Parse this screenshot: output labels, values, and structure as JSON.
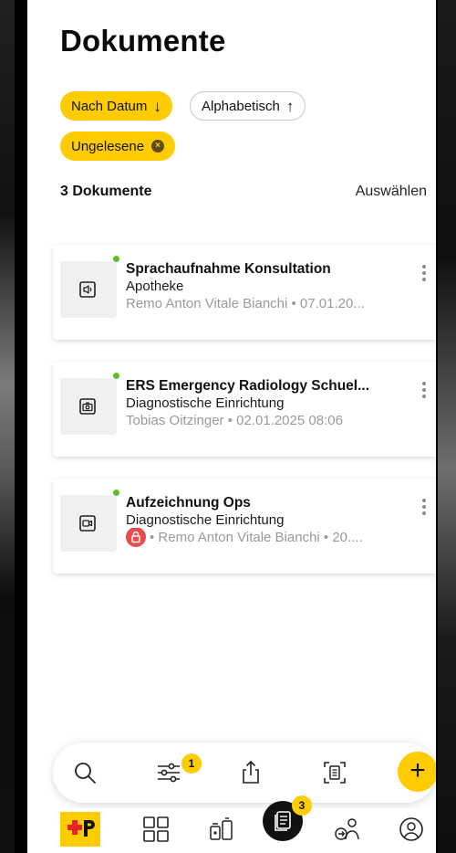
{
  "header": {
    "title": "Dokumente"
  },
  "filters": {
    "sort_date": {
      "label": "Nach Datum",
      "arrow": "↓"
    },
    "sort_alpha": {
      "label": "Alphabetisch",
      "arrow": "↑"
    },
    "unread": {
      "label": "Ungelesene",
      "clear": "×"
    }
  },
  "list": {
    "count_label": "3 Dokumente",
    "select_label": "Auswählen"
  },
  "documents": [
    {
      "title": "Sprachaufnahme Konsultation",
      "category": "Apotheke",
      "meta": "Remo Anton Vitale Bianchi • 07.01.20...",
      "icon": "audio-file-icon",
      "unread": true,
      "locked": false
    },
    {
      "title": "ERS Emergency Radiology Schuel...",
      "category": "Diagnostische Einrichtung",
      "meta": "Tobias Oitzinger • 02.01.2025 08:06",
      "icon": "camera-file-icon",
      "unread": true,
      "locked": false
    },
    {
      "title": "Aufzeichnung Ops",
      "category": "Diagnostische Einrichtung",
      "meta": "• Remo Anton Vitale Bianchi • 20....",
      "icon": "video-file-icon",
      "unread": true,
      "locked": true
    }
  ],
  "toolbar": {
    "filter_badge": "1",
    "add": "+"
  },
  "tabbar": {
    "documents_badge": "3"
  },
  "colors": {
    "accent": "#ffcc00",
    "unread_dot": "#5bbf2a",
    "lock": "#e84c4c",
    "brand_red": "#e8222b"
  }
}
